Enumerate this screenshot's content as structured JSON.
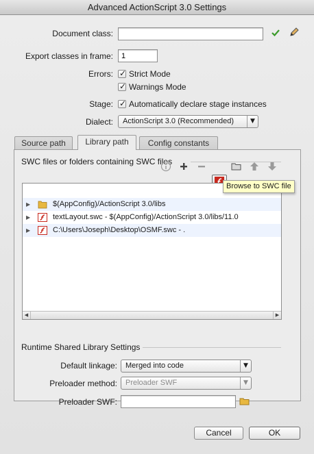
{
  "window": {
    "title": "Advanced ActionScript 3.0 Settings"
  },
  "document_class": {
    "label": "Document class:",
    "value": ""
  },
  "export_frame": {
    "label": "Export classes in frame:",
    "value": "1"
  },
  "errors": {
    "label": "Errors:",
    "strict_mode": {
      "label": "Strict Mode",
      "checked": true
    },
    "warnings_mode": {
      "label": "Warnings Mode",
      "checked": true
    }
  },
  "stage": {
    "label": "Stage:",
    "option": {
      "label": "Automatically declare stage instances",
      "checked": true
    }
  },
  "dialect": {
    "label": "Dialect:",
    "selected": "ActionScript 3.0 (Recommended)"
  },
  "tabs": [
    {
      "label": "Source path",
      "active": false
    },
    {
      "label": "Library path",
      "active": true
    },
    {
      "label": "Config constants",
      "active": false
    }
  ],
  "library": {
    "heading": "SWC files or folders containing SWC files",
    "toolbar": [
      "info-icon",
      "add-icon",
      "remove-icon",
      "browse-swc-icon",
      "folder-icon",
      "up-arrow-icon",
      "down-arrow-icon"
    ],
    "tooltip": "Browse to SWC file",
    "items": [
      {
        "icon": "folder-icon",
        "text": "$(AppConfig)/ActionScript 3.0/libs"
      },
      {
        "icon": "swc-icon",
        "text": "textLayout.swc - $(AppConfig)/ActionScript 3.0/libs/11.0"
      },
      {
        "icon": "swc-icon",
        "text": "C:\\Users\\Joseph\\Desktop\\OSMF.swc - ."
      }
    ]
  },
  "rsl": {
    "heading": "Runtime Shared Library Settings",
    "default_linkage": {
      "label": "Default linkage:",
      "selected": "Merged into code"
    },
    "preloader_method": {
      "label": "Preloader method:",
      "selected": "Preloader SWF"
    },
    "preloader_swf": {
      "label": "Preloader SWF:",
      "value": ""
    }
  },
  "buttons": {
    "cancel": "Cancel",
    "ok": "OK"
  },
  "colors": {
    "swc_red": "#c8281e",
    "folder_yellow": "#e8b840",
    "check_green": "#3a9a2a",
    "tooltip_bg": "#ffffc7"
  }
}
